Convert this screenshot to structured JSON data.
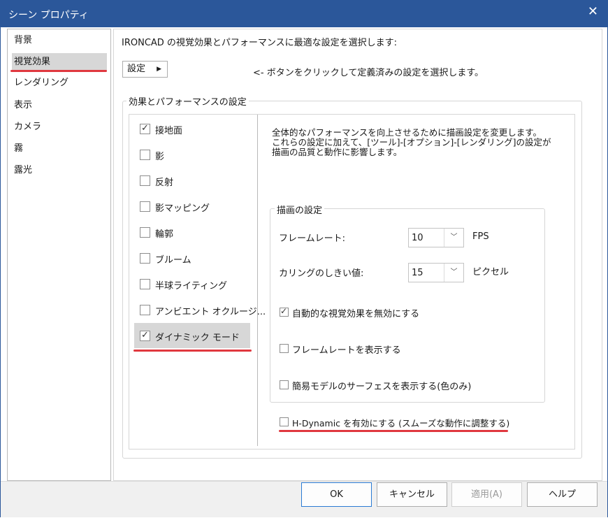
{
  "window": {
    "title": "シーン プロパティ",
    "close_glyph": "✕"
  },
  "sidebar": {
    "items": [
      {
        "label": "背景",
        "selected": false
      },
      {
        "label": "視覚効果",
        "selected": true
      },
      {
        "label": "レンダリング",
        "selected": false
      },
      {
        "label": "表示",
        "selected": false
      },
      {
        "label": "カメラ",
        "selected": false
      },
      {
        "label": "霧",
        "selected": false
      },
      {
        "label": "露光",
        "selected": false
      }
    ]
  },
  "main": {
    "intro_text": "IRONCAD の視覚効果とパフォーマンスに最適な設定を選択します:",
    "preset_button_label": "設定",
    "preset_button_arrow": "▶",
    "preset_hint": "<- ボタンをクリックして定義済みの設定を選択します。",
    "group_title": "効果とパフォーマンスの設定",
    "effects": [
      {
        "label": "接地面",
        "checked": true
      },
      {
        "label": "影",
        "checked": false
      },
      {
        "label": "反射",
        "checked": false
      },
      {
        "label": "影マッピング",
        "checked": false
      },
      {
        "label": "輪郭",
        "checked": false
      },
      {
        "label": "ブルーム",
        "checked": false
      },
      {
        "label": "半球ライティング",
        "checked": false
      },
      {
        "label": "アンビエント オクルージ...",
        "checked": false
      },
      {
        "label": "ダイナミック モード",
        "checked": true,
        "selected": true
      }
    ],
    "description_lines": [
      "全体的なパフォーマンスを向上させるために描画設定を変更します。",
      "これらの設定に加えて、[ツール]-[オプション]-[レンダリング]の設定が",
      "描画の品質と動作に影響します。"
    ],
    "render_group": {
      "title": "描画の設定",
      "frame_rate_label": "フレームレート:",
      "frame_rate_value": "10",
      "frame_rate_unit": "FPS",
      "culling_label": "カリングのしきい値:",
      "culling_value": "15",
      "culling_unit": "ピクセル",
      "combo_arrow": "﹀",
      "options": [
        {
          "label": "自動的な視覚効果を無効にする",
          "checked": true
        },
        {
          "label": "フレームレートを表示する",
          "checked": false
        },
        {
          "label": "簡易モデルのサーフェスを表示する(色のみ)",
          "checked": false
        }
      ]
    },
    "h_dynamic": {
      "label": "H-Dynamic を有効にする (スムーズな動作に調整する)",
      "checked": false
    }
  },
  "footer": {
    "ok_label": "OK",
    "cancel_label": "キャンセル",
    "apply_label": "適用(A)",
    "help_label": "ヘルプ"
  },
  "colors": {
    "titlebar": "#2b579a",
    "highlight_underline": "#e0383f",
    "selection": "#d7d7d7"
  }
}
